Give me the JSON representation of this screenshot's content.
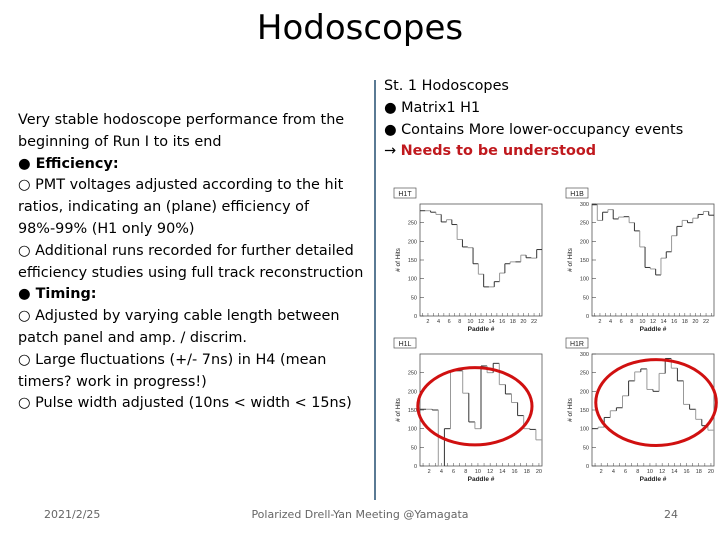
{
  "title": "Hodoscopes",
  "left": {
    "intro": "Very stable hodoscope performance from the beginning of Run I to its end",
    "sections": [
      {
        "heading": "● Efficiency:",
        "items": [
          "○ PMT voltages adjusted according to the hit ratios, indicating an (plane) efficiency of 98%-99% (H1 only 90%)",
          "○ Additional runs recorded for further detailed efficiency studies using full track reconstruction"
        ]
      },
      {
        "heading": "● Timing:",
        "items": [
          "○ Adjusted by varying cable length between patch panel and amp. / discrim.",
          "○ Large fluctuations (+/- 7ns) in H4 (mean timers? work in progress!)",
          "○ Pulse width adjusted (10ns < width < 15ns)"
        ]
      }
    ]
  },
  "right": {
    "heading": "St. 1 Hodoscopes",
    "bullets": [
      "● Matrix1 H1",
      "● Contains More lower-occupancy events"
    ],
    "arrow": "→",
    "note": "Needs to be understood",
    "note_color": "#c0191e"
  },
  "chart_data": [
    {
      "type": "line",
      "title": "H1T",
      "xlabel": "Paddle #",
      "ylabel": "# of Hits",
      "xlim": [
        0.5,
        23.5
      ],
      "ylim": [
        0,
        300
      ],
      "x_ticks": [
        "2",
        "4",
        "6",
        "8",
        "10",
        "12",
        "14",
        "16",
        "18",
        "20",
        "22"
      ],
      "y_ticks": [
        "0",
        "50",
        "100",
        "150",
        "200",
        "250"
      ],
      "x": [
        1,
        2,
        3,
        4,
        5,
        6,
        7,
        8,
        9,
        10,
        11,
        12,
        13,
        14,
        15,
        16,
        17,
        18,
        19,
        20,
        21,
        22,
        23
      ],
      "values": [
        282,
        282,
        278,
        272,
        252,
        258,
        245,
        205,
        185,
        183,
        140,
        112,
        78,
        78,
        92,
        115,
        140,
        145,
        145,
        163,
        156,
        155,
        178
      ]
    },
    {
      "type": "line",
      "title": "H1B",
      "xlabel": "Paddle #",
      "ylabel": "# of Hits",
      "xlim": [
        0.5,
        23.5
      ],
      "ylim": [
        0,
        300
      ],
      "x_ticks": [
        "2",
        "4",
        "6",
        "8",
        "10",
        "12",
        "14",
        "16",
        "18",
        "20",
        "22"
      ],
      "y_ticks": [
        "0",
        "50",
        "100",
        "150",
        "200",
        "250",
        "300"
      ],
      "x": [
        1,
        2,
        3,
        4,
        5,
        6,
        7,
        8,
        9,
        10,
        11,
        12,
        13,
        14,
        15,
        16,
        17,
        18,
        19,
        20,
        21,
        22,
        23
      ],
      "values": [
        298,
        256,
        278,
        285,
        260,
        265,
        266,
        250,
        228,
        185,
        130,
        126,
        110,
        155,
        172,
        215,
        240,
        256,
        250,
        262,
        272,
        280,
        270
      ]
    },
    {
      "type": "line",
      "title": "H1L",
      "xlabel": "Paddle #",
      "ylabel": "# of Hits",
      "xlim": [
        0.5,
        20.5
      ],
      "ylim": [
        0,
        300
      ],
      "x_ticks": [
        "2",
        "4",
        "6",
        "8",
        "10",
        "12",
        "14",
        "16",
        "18",
        "20"
      ],
      "y_ticks": [
        "0",
        "50",
        "100",
        "150",
        "200",
        "250"
      ],
      "x": [
        1,
        2,
        3,
        4,
        5,
        6,
        7,
        8,
        9,
        10,
        11,
        12,
        13,
        14,
        15,
        16,
        17,
        18,
        19,
        20
      ],
      "values": [
        152,
        152,
        150,
        0,
        100,
        255,
        255,
        195,
        118,
        100,
        268,
        250,
        275,
        218,
        193,
        170,
        135,
        100,
        98,
        70
      ],
      "annotation": "red ellipse around paddles 7-11"
    },
    {
      "type": "line",
      "title": "H1R",
      "xlabel": "Paddle #",
      "ylabel": "# of Hits",
      "xlim": [
        0.5,
        20.5
      ],
      "ylim": [
        0,
        300
      ],
      "x_ticks": [
        "2",
        "4",
        "6",
        "8",
        "10",
        "12",
        "14",
        "16",
        "18",
        "20"
      ],
      "y_ticks": [
        "0",
        "50",
        "100",
        "150",
        "200",
        "250",
        "300"
      ],
      "x": [
        1,
        2,
        3,
        4,
        5,
        6,
        7,
        8,
        9,
        10,
        11,
        12,
        13,
        14,
        15,
        16,
        17,
        18,
        19,
        20
      ],
      "values": [
        100,
        104,
        130,
        148,
        156,
        188,
        228,
        252,
        260,
        205,
        200,
        248,
        288,
        262,
        228,
        165,
        152,
        125,
        108,
        96
      ],
      "annotation": "red ellipse around paddles 7-14"
    }
  ],
  "footer": {
    "date": "2021/2/25",
    "center": "Polarized Drell-Yan Meeting @Yamagata",
    "page": "24"
  }
}
